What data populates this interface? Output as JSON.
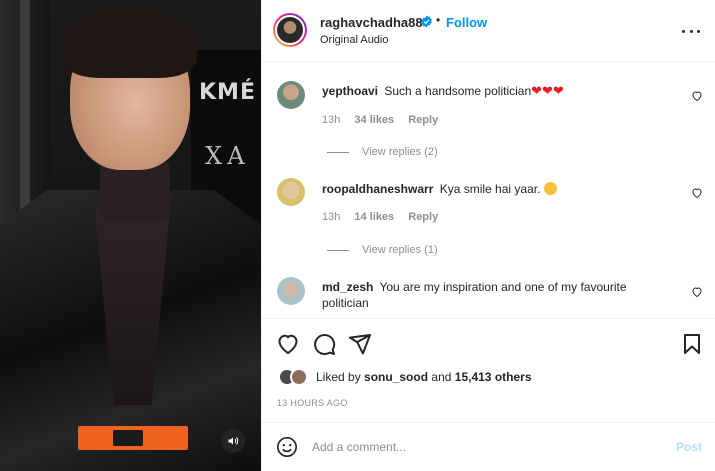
{
  "media": {
    "banner_text_1": "KMÉ",
    "banner_text_2": "XA",
    "mute_icon": "speaker-icon"
  },
  "header": {
    "username": "raghavchadha88",
    "separator": "•",
    "follow_label": "Follow",
    "audio_label": "Original Audio",
    "verified_icon": "verified-badge-icon",
    "more_icon": "more-options-icon"
  },
  "comments": [
    {
      "username": "yepthoavi",
      "text": "Such a handsome politician",
      "emoji": "❤❤❤",
      "time": "13h",
      "likes": "34 likes",
      "reply_label": "Reply",
      "view_replies": "View replies (2)"
    },
    {
      "username": "roopaldhaneshwarr",
      "text": "Kya smile hai yaar.",
      "emoji": "face-emoji",
      "time": "13h",
      "likes": "14 likes",
      "reply_label": "Reply",
      "view_replies": "View replies (1)"
    },
    {
      "username": "md_zesh",
      "text": "You are my inspiration and one of my favourite politician"
    }
  ],
  "actions": {
    "like_icon": "heart-icon",
    "comment_icon": "comment-icon",
    "share_icon": "share-icon",
    "save_icon": "bookmark-icon"
  },
  "likes": {
    "prefix": "Liked by",
    "user": "sonu_sood",
    "middle": "and",
    "others": "15,413 others"
  },
  "timestamp": "13 HOURS AGO",
  "add_comment": {
    "placeholder": "Add a comment...",
    "post_label": "Post"
  },
  "colors": {
    "accent": "#0095f6",
    "muted": "#8e8e8e",
    "post_disabled": "#b2dffc"
  }
}
